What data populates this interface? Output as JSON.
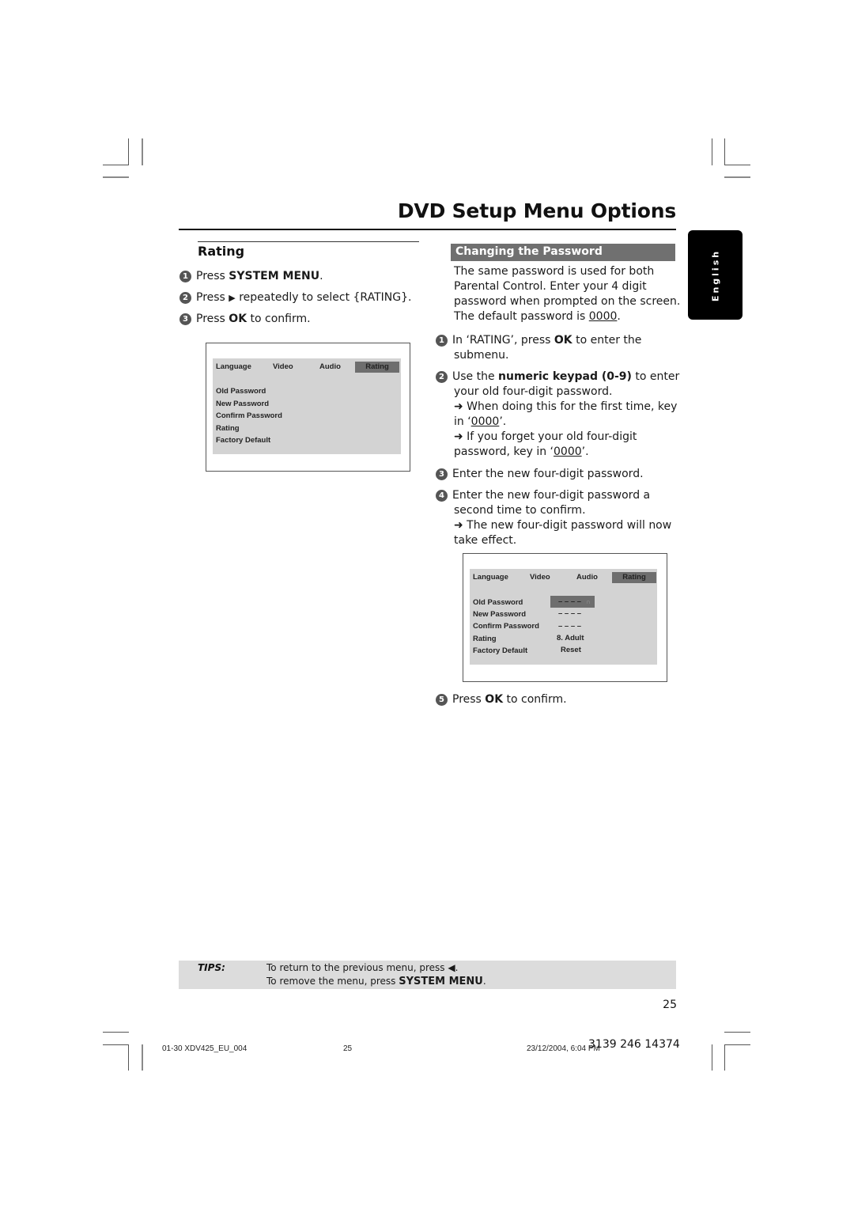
{
  "header": {
    "page_title": "DVD Setup Menu Options"
  },
  "language_tab": {
    "label": "English"
  },
  "left_section": {
    "heading": "Rating",
    "steps": [
      {
        "num": "1",
        "pre": "Press ",
        "bold": "SYSTEM MENU",
        "post": "."
      },
      {
        "num": "2",
        "pre": "Press ",
        "icon": "right-arrow",
        "icon_glyph": "▶",
        "post": " repeatedly to select {RATING}."
      },
      {
        "num": "3",
        "pre": "Press ",
        "bold": "OK",
        "post": " to confirm."
      }
    ],
    "osd": {
      "tabs": [
        "Language",
        "Video",
        "Audio",
        "Rating"
      ],
      "active_tab": "Rating",
      "items": [
        "Old Password",
        "New Password",
        "Confirm Password",
        "Rating",
        "Factory Default"
      ]
    }
  },
  "right_section": {
    "heading": "Changing the Password",
    "intro_lines": [
      "The same password is used for both",
      "Parental Control. Enter your 4 digit",
      "password when prompted on the screen.",
      "The default password is "
    ],
    "intro_default": "0000",
    "intro_end": ".",
    "step1": {
      "num": "1",
      "pre": "In ‘RATING’, press ",
      "bold": "OK",
      "post": " to enter the",
      "line2": "submenu."
    },
    "step2": {
      "num": "2",
      "pre": "Use the ",
      "bold": "numeric keypad (0-9)",
      "post": " to enter",
      "line2": "your old four-digit password.",
      "note1_line1": "➜ When doing this for the first time, key",
      "note1_line2_pre": "in ‘",
      "note1_code": "0000",
      "note1_line2_post": "’.",
      "note2_line1": "➜ If you forget your old four-digit",
      "note2_line2_pre": "password, key in ‘",
      "note2_code": "0000",
      "note2_line2_post": "’."
    },
    "step3": {
      "num": "3",
      "text": "Enter the new four-digit password."
    },
    "step4": {
      "num": "4",
      "line1": "Enter the new four-digit password a",
      "line2": "second time to confirm.",
      "note_line1": "➜ The new four-digit password will now",
      "note_line2": "take effect."
    },
    "osd": {
      "tabs": [
        "Language",
        "Video",
        "Audio",
        "Rating"
      ],
      "active_tab": "Rating",
      "items": [
        {
          "label": "Old Password",
          "value": "– – – –",
          "active": true,
          "icon": "lock-icon"
        },
        {
          "label": "New Password",
          "value": "– – – –"
        },
        {
          "label": "Confirm Password",
          "value": "– – – –"
        },
        {
          "label": "Rating",
          "value": "8. Adult"
        },
        {
          "label": "Factory Default",
          "value": "Reset"
        }
      ]
    },
    "step5": {
      "num": "5",
      "pre": "Press ",
      "bold": "OK",
      "post": " to confirm."
    }
  },
  "tips": {
    "label": "TIPS:",
    "line1": "To return to the previous menu, press ◀.",
    "line2_pre": "To remove the menu, press ",
    "line2_bold": "SYSTEM MENU",
    "line2_post": "."
  },
  "page_number": "25",
  "footer": {
    "file": "01-30 XDV425_EU_004",
    "page": "25",
    "datetime": "23/12/2004, 6:04 PM",
    "doc_code": "3139 246 14374"
  }
}
